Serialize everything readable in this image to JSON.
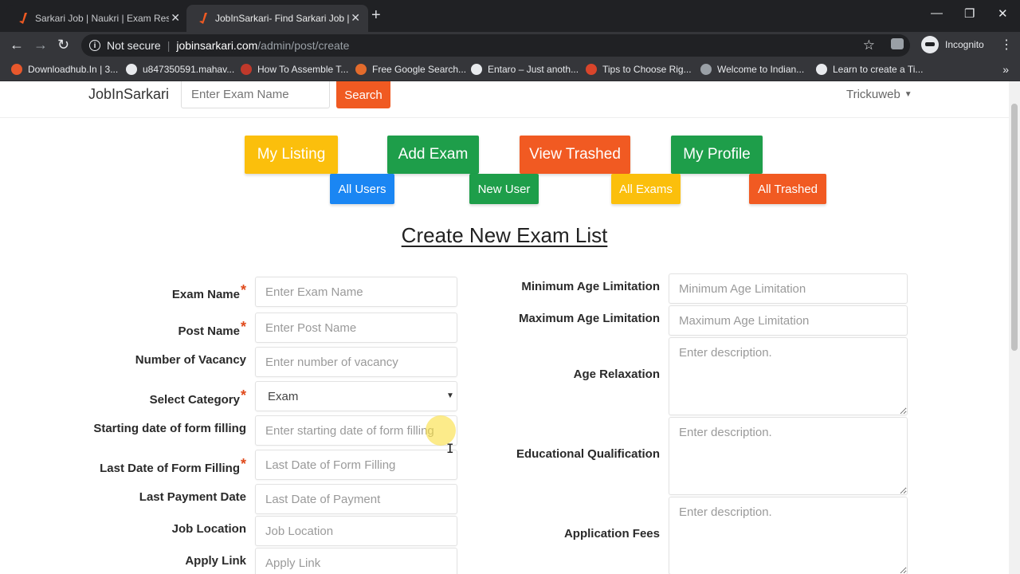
{
  "browser": {
    "tabs": [
      {
        "title": "Sarkari Job | Naukri | Exam Result",
        "active": false
      },
      {
        "title": "JobInSarkari- Find Sarkari Job | A",
        "active": true
      }
    ],
    "security_label": "Not secure",
    "url_host": "jobinsarkari.com",
    "url_path": "/admin/post/create",
    "profile_label": "Incognito",
    "bookmarks": [
      {
        "label": "Downloadhub.In | 3...",
        "color": "#e8582c"
      },
      {
        "label": "u847350591.mahav...",
        "color": "#e8eaed"
      },
      {
        "label": "How To Assemble T...",
        "color": "#c0392b"
      },
      {
        "label": "Free Google Search...",
        "color": "#e36b2c"
      },
      {
        "label": "Entaro – Just anoth...",
        "color": "#e8eaed"
      },
      {
        "label": "Tips to Choose Rig...",
        "color": "#d9452b"
      },
      {
        "label": "Welcome to Indian...",
        "color": "#9aa0a6"
      },
      {
        "label": "Learn to create a Ti...",
        "color": "#e8eaed"
      }
    ]
  },
  "site": {
    "brand": "JobInSarkari",
    "search_placeholder": "Enter Exam Name",
    "search_button": "Search",
    "user": "Trickuweb"
  },
  "actions": {
    "primary": [
      {
        "label": "My Listing",
        "color": "#fbbf0c"
      },
      {
        "label": "Add Exam",
        "color": "#1e9e4a"
      },
      {
        "label": "View Trashed",
        "color": "#f15a22"
      },
      {
        "label": "My Profile",
        "color": "#1e9e4a"
      }
    ],
    "secondary": [
      {
        "label": "All Users",
        "color": "#1a86f3"
      },
      {
        "label": "New User",
        "color": "#1e9e4a"
      },
      {
        "label": "All Exams",
        "color": "#fbbf0c"
      },
      {
        "label": "All Trashed",
        "color": "#f15a22"
      }
    ]
  },
  "form": {
    "title": "Create New Exam List",
    "left_fields": [
      {
        "label": "Exam Name",
        "required": true,
        "placeholder": "Enter Exam Name"
      },
      {
        "label": "Post Name",
        "required": true,
        "placeholder": "Enter Post Name"
      },
      {
        "label": "Number of Vacancy",
        "required": false,
        "placeholder": "Enter number of vacancy"
      },
      {
        "label": "Select Category",
        "required": true,
        "value": "Exam"
      },
      {
        "label": "Starting date of form filling",
        "required": false,
        "placeholder": "Enter starting date of form filling"
      },
      {
        "label": "Last Date of Form Filling",
        "required": true,
        "placeholder": "Last Date of Form Filling"
      },
      {
        "label": "Last Payment Date",
        "required": false,
        "placeholder": "Last Date of Payment"
      },
      {
        "label": "Job Location",
        "required": false,
        "placeholder": "Job Location"
      },
      {
        "label": "Apply Link",
        "required": false,
        "placeholder": "Apply Link"
      }
    ],
    "right_fields": [
      {
        "label": "Minimum Age Limitation",
        "placeholder": "Minimum Age Limitation"
      },
      {
        "label": "Maximum Age Limitation",
        "placeholder": "Maximum Age Limitation"
      },
      {
        "label": "Age Relaxation",
        "placeholder": "Enter description."
      },
      {
        "label": "Educational Qualification",
        "placeholder": "Enter description."
      },
      {
        "label": "Application Fees",
        "placeholder": "Enter description."
      }
    ],
    "required_mark": "*"
  }
}
